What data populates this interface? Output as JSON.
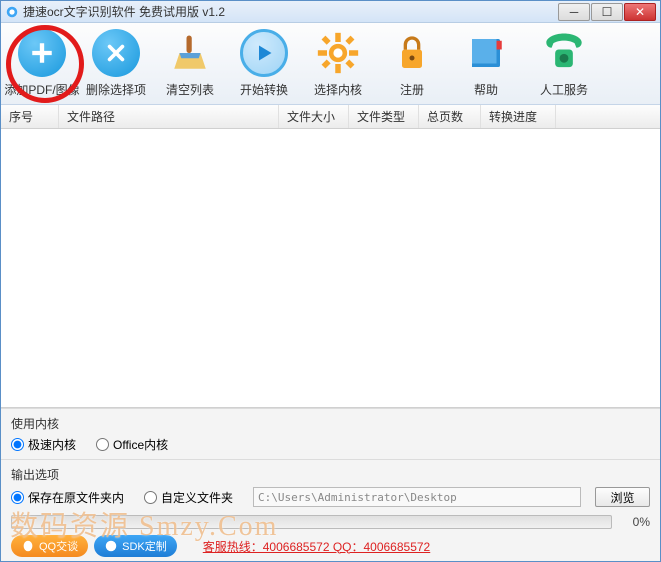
{
  "title": "捷速ocr文字识别软件 免费试用版 v1.2",
  "toolbar": [
    {
      "label": "添加PDF/图像",
      "icon": "plus",
      "color": "#2aa7e6"
    },
    {
      "label": "删除选择项",
      "icon": "x",
      "color": "#2aa7e6"
    },
    {
      "label": "清空列表",
      "icon": "broom",
      "color": "#e6a23c"
    },
    {
      "label": "开始转换",
      "icon": "play",
      "color": "#2aa7e6"
    },
    {
      "label": "选择内核",
      "icon": "gear",
      "color": "#f5a623"
    },
    {
      "label": "注册",
      "icon": "lock",
      "color": "#f5a623"
    },
    {
      "label": "帮助",
      "icon": "book",
      "color": "#2aa7e6"
    },
    {
      "label": "人工服务",
      "icon": "phone",
      "color": "#2bb673"
    }
  ],
  "columns": [
    "序号",
    "文件路径",
    "文件大小",
    "文件类型",
    "总页数",
    "转换进度"
  ],
  "kernel": {
    "title": "使用内核",
    "options": [
      "极速内核",
      "Office内核"
    ],
    "selected": 0
  },
  "output": {
    "title": "输出选项",
    "options": [
      "保存在原文件夹内",
      "自定义文件夹"
    ],
    "selected": 0,
    "path": "C:\\Users\\Administrator\\Desktop",
    "browse": "浏览"
  },
  "progress": "0%",
  "bottom": {
    "qq": "QQ交谈",
    "sdk": "SDK定制",
    "hotline": "客服热线：4006685572 QQ：4006685572"
  },
  "watermark": "数码资源 Smzy.Com"
}
